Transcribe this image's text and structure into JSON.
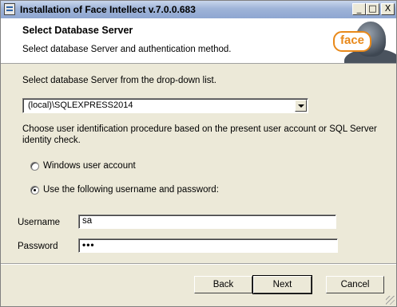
{
  "window": {
    "title": "Installation of Face Intellect v.7.0.0.683",
    "controls": {
      "minimize": "_",
      "maximize": "□",
      "close": "X"
    }
  },
  "header": {
    "title": "Select Database Server",
    "subtitle": "Select database Server and authentication method.",
    "logo_text": "face"
  },
  "content": {
    "server_prompt": "Select database Server from the drop-down list.",
    "server_select": {
      "value": "(local)\\SQLEXPRESS2014"
    },
    "auth_prompt_line1": "Choose user identification procedure based on the present user account or SQL Server",
    "auth_prompt_line2": "identity check.",
    "auth_options": [
      {
        "label": "Windows user account",
        "checked": false
      },
      {
        "label": "Use the following username and password:",
        "checked": true
      }
    ],
    "username": {
      "label": "Username",
      "value": "sa"
    },
    "password": {
      "label": "Password",
      "value": "•••"
    }
  },
  "footer": {
    "back_label": "Back",
    "next_label": "Next",
    "cancel_label": "Cancel"
  },
  "icons": [
    "installer-icon",
    "minimize-icon",
    "maximize-icon",
    "close-icon",
    "dropdown-arrow-icon",
    "face-logo-icon",
    "resize-grip-icon"
  ]
}
